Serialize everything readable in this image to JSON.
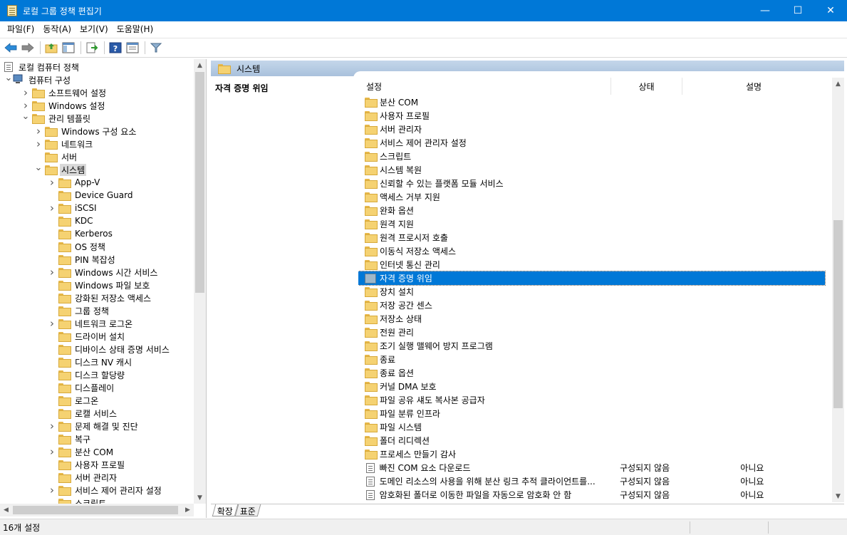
{
  "window": {
    "title": "로컬 그룹 정책 편집기",
    "minimize": "—",
    "maximize": "☐",
    "close": "✕"
  },
  "menu": [
    "파일(F)",
    "동작(A)",
    "보기(V)",
    "도움말(H)"
  ],
  "tree": {
    "rows": [
      {
        "label": "로컬 컴퓨터 정책",
        "depth": 0,
        "chev": "",
        "icon": "policy"
      },
      {
        "label": "컴퓨터 구성",
        "depth": 0,
        "chev": "open",
        "icon": "computer"
      },
      {
        "label": "소프트웨어 설정",
        "depth": 1,
        "chev": "closed",
        "icon": "folder"
      },
      {
        "label": "Windows 설정",
        "depth": 1,
        "chev": "closed",
        "icon": "folder"
      },
      {
        "label": "관리 템플릿",
        "depth": 1,
        "chev": "open",
        "icon": "folder"
      },
      {
        "label": "Windows 구성 요소",
        "depth": 2,
        "chev": "closed",
        "icon": "folder"
      },
      {
        "label": "네트워크",
        "depth": 2,
        "chev": "closed",
        "icon": "folder"
      },
      {
        "label": "서버",
        "depth": 2,
        "chev": "",
        "icon": "folder"
      },
      {
        "label": "시스템",
        "depth": 2,
        "chev": "open",
        "icon": "folder",
        "selected": true
      },
      {
        "label": "App-V",
        "depth": 3,
        "chev": "closed",
        "icon": "folder"
      },
      {
        "label": "Device Guard",
        "depth": 3,
        "chev": "",
        "icon": "folder"
      },
      {
        "label": "iSCSI",
        "depth": 3,
        "chev": "closed",
        "icon": "folder"
      },
      {
        "label": "KDC",
        "depth": 3,
        "chev": "",
        "icon": "folder"
      },
      {
        "label": "Kerberos",
        "depth": 3,
        "chev": "",
        "icon": "folder"
      },
      {
        "label": "OS 정책",
        "depth": 3,
        "chev": "",
        "icon": "folder"
      },
      {
        "label": "PIN 복잡성",
        "depth": 3,
        "chev": "",
        "icon": "folder"
      },
      {
        "label": "Windows 시간 서비스",
        "depth": 3,
        "chev": "closed",
        "icon": "folder"
      },
      {
        "label": "Windows 파일 보호",
        "depth": 3,
        "chev": "",
        "icon": "folder"
      },
      {
        "label": "강화된 저장소 액세스",
        "depth": 3,
        "chev": "",
        "icon": "folder"
      },
      {
        "label": "그룹 정책",
        "depth": 3,
        "chev": "",
        "icon": "folder"
      },
      {
        "label": "네트워크 로그온",
        "depth": 3,
        "chev": "closed",
        "icon": "folder"
      },
      {
        "label": "드라이버 설치",
        "depth": 3,
        "chev": "",
        "icon": "folder"
      },
      {
        "label": "디바이스 상태 증명 서비스",
        "depth": 3,
        "chev": "",
        "icon": "folder"
      },
      {
        "label": "디스크 NV 캐시",
        "depth": 3,
        "chev": "",
        "icon": "folder"
      },
      {
        "label": "디스크 할당량",
        "depth": 3,
        "chev": "",
        "icon": "folder"
      },
      {
        "label": "디스플레이",
        "depth": 3,
        "chev": "",
        "icon": "folder"
      },
      {
        "label": "로그온",
        "depth": 3,
        "chev": "",
        "icon": "folder"
      },
      {
        "label": "로캘 서비스",
        "depth": 3,
        "chev": "",
        "icon": "folder"
      },
      {
        "label": "문제 해결 및 진단",
        "depth": 3,
        "chev": "closed",
        "icon": "folder"
      },
      {
        "label": "복구",
        "depth": 3,
        "chev": "",
        "icon": "folder"
      },
      {
        "label": "분산 COM",
        "depth": 3,
        "chev": "closed",
        "icon": "folder"
      },
      {
        "label": "사용자 프로필",
        "depth": 3,
        "chev": "",
        "icon": "folder"
      },
      {
        "label": "서버 관리자",
        "depth": 3,
        "chev": "",
        "icon": "folder"
      },
      {
        "label": "서비스 제어 관리자 설정",
        "depth": 3,
        "chev": "closed",
        "icon": "folder"
      },
      {
        "label": "스크립트",
        "depth": 3,
        "chev": "",
        "icon": "folder"
      }
    ]
  },
  "right": {
    "crumb": "시스템",
    "extended_title": "자격 증명 위임",
    "columns": {
      "setting": "설정",
      "state": "상태",
      "comment": "설명"
    },
    "rows": [
      {
        "name": "분산 COM",
        "type": "folder"
      },
      {
        "name": "사용자 프로필",
        "type": "folder"
      },
      {
        "name": "서버 관리자",
        "type": "folder"
      },
      {
        "name": "서비스 제어 관리자 설정",
        "type": "folder"
      },
      {
        "name": "스크립트",
        "type": "folder"
      },
      {
        "name": "시스템 복원",
        "type": "folder"
      },
      {
        "name": "신뢰할 수 있는 플랫폼 모듈 서비스",
        "type": "folder"
      },
      {
        "name": "액세스 거부 지원",
        "type": "folder"
      },
      {
        "name": "완화 옵션",
        "type": "folder"
      },
      {
        "name": "원격 지원",
        "type": "folder"
      },
      {
        "name": "원격 프로시저 호출",
        "type": "folder"
      },
      {
        "name": "이동식 저장소 액세스",
        "type": "folder"
      },
      {
        "name": "인터넷 통신 관리",
        "type": "folder"
      },
      {
        "name": "자격 증명 위임",
        "type": "folder-selected",
        "selected": true
      },
      {
        "name": "장치 설치",
        "type": "folder"
      },
      {
        "name": "저장 공간 센스",
        "type": "folder"
      },
      {
        "name": "저장소 상태",
        "type": "folder"
      },
      {
        "name": "전원 관리",
        "type": "folder"
      },
      {
        "name": "조기 실행 맬웨어 방지 프로그램",
        "type": "folder"
      },
      {
        "name": "종료",
        "type": "folder"
      },
      {
        "name": "종료 옵션",
        "type": "folder"
      },
      {
        "name": "커널 DMA 보호",
        "type": "folder"
      },
      {
        "name": "파일 공유 섀도 복사본 공급자",
        "type": "folder"
      },
      {
        "name": "파일 분류 인프라",
        "type": "folder"
      },
      {
        "name": "파일 시스템",
        "type": "folder"
      },
      {
        "name": "폴더 리디렉션",
        "type": "folder"
      },
      {
        "name": "프로세스 만들기 감사",
        "type": "folder"
      },
      {
        "name": "빠진 COM 요소 다운로드",
        "type": "setting",
        "state": "구성되지 않음",
        "comment": "아니요"
      },
      {
        "name": "도메인 리소스의 사용을 위해 분산 링크 추적 클라이언트를...",
        "type": "setting",
        "state": "구성되지 않음",
        "comment": "아니요"
      },
      {
        "name": "암호화된 폴더로 이동한 파일을 자동으로 암호화 안 함",
        "type": "setting",
        "state": "구성되지 않음",
        "comment": "아니요"
      }
    ],
    "tabs": [
      "확장",
      "표준"
    ]
  },
  "status": {
    "text": "16개 설정"
  }
}
